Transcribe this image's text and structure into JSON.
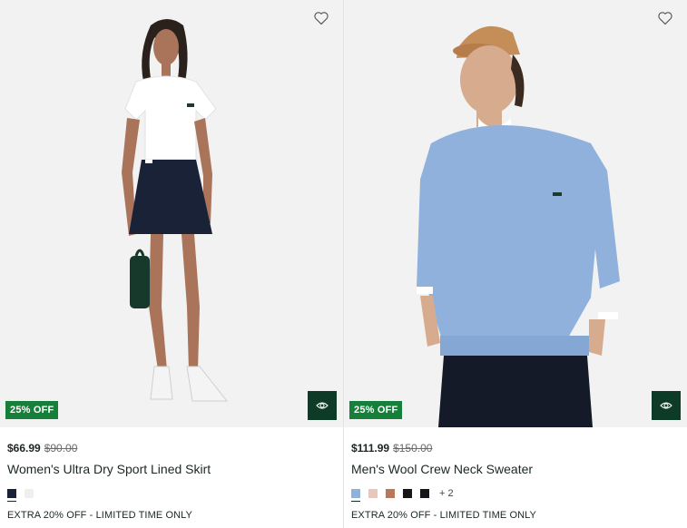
{
  "products": [
    {
      "badge": "25% OFF",
      "price_now": "$66.99",
      "price_old": "$90.00",
      "name": "Women's Ultra Dry Sport Lined Skirt",
      "swatches": [
        "#1a2238",
        "#efefef"
      ],
      "more_colors": "",
      "promo": "EXTRA 20% OFF - LIMITED TIME ONLY"
    },
    {
      "badge": "25% OFF",
      "price_now": "$111.99",
      "price_old": "$150.00",
      "name": "Men's Wool Crew Neck Sweater",
      "swatches": [
        "#8fb1dc",
        "#e7c7bd",
        "#b9785a",
        "#15161a",
        "#15161a"
      ],
      "more_colors": "+ 2",
      "promo": "EXTRA 20% OFF - LIMITED TIME ONLY"
    }
  ],
  "icons": {
    "wishlist": "heart-outline-icon",
    "quick_view": "eye-icon"
  },
  "colors": {
    "badge": "#16803a",
    "quick_view_bg": "#0e3b28"
  }
}
